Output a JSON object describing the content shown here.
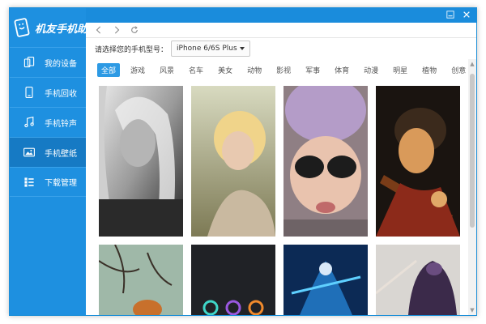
{
  "app": {
    "title": "机友手机助手"
  },
  "sidebar": {
    "items": [
      {
        "label": "我的设备",
        "icon": "phone-device-icon",
        "active": false
      },
      {
        "label": "手机回收",
        "icon": "phone-recycle-icon",
        "active": false
      },
      {
        "label": "手机铃声",
        "icon": "music-note-icon",
        "active": false
      },
      {
        "label": "手机壁纸",
        "icon": "wallpaper-image-icon",
        "active": true
      },
      {
        "label": "下载管理",
        "icon": "download-list-icon",
        "active": false
      }
    ]
  },
  "toolbar": {
    "back_icon": "chevron-left-icon",
    "forward_icon": "chevron-right-icon",
    "refresh_icon": "refresh-icon"
  },
  "model": {
    "label": "请选择您的手机型号：",
    "selected": "iPhone 6/6S Plus"
  },
  "categories": [
    "全部",
    "游戏",
    "风景",
    "名车",
    "美女",
    "动物",
    "影视",
    "军事",
    "体育",
    "动漫",
    "明星",
    "植物",
    "创意"
  ],
  "active_category": "全部",
  "colors": {
    "sidebar": "#1e90e0",
    "sidebar_active": "#167ac4",
    "topbar": "#1a8cdc",
    "accent": "#2d9ae4"
  }
}
